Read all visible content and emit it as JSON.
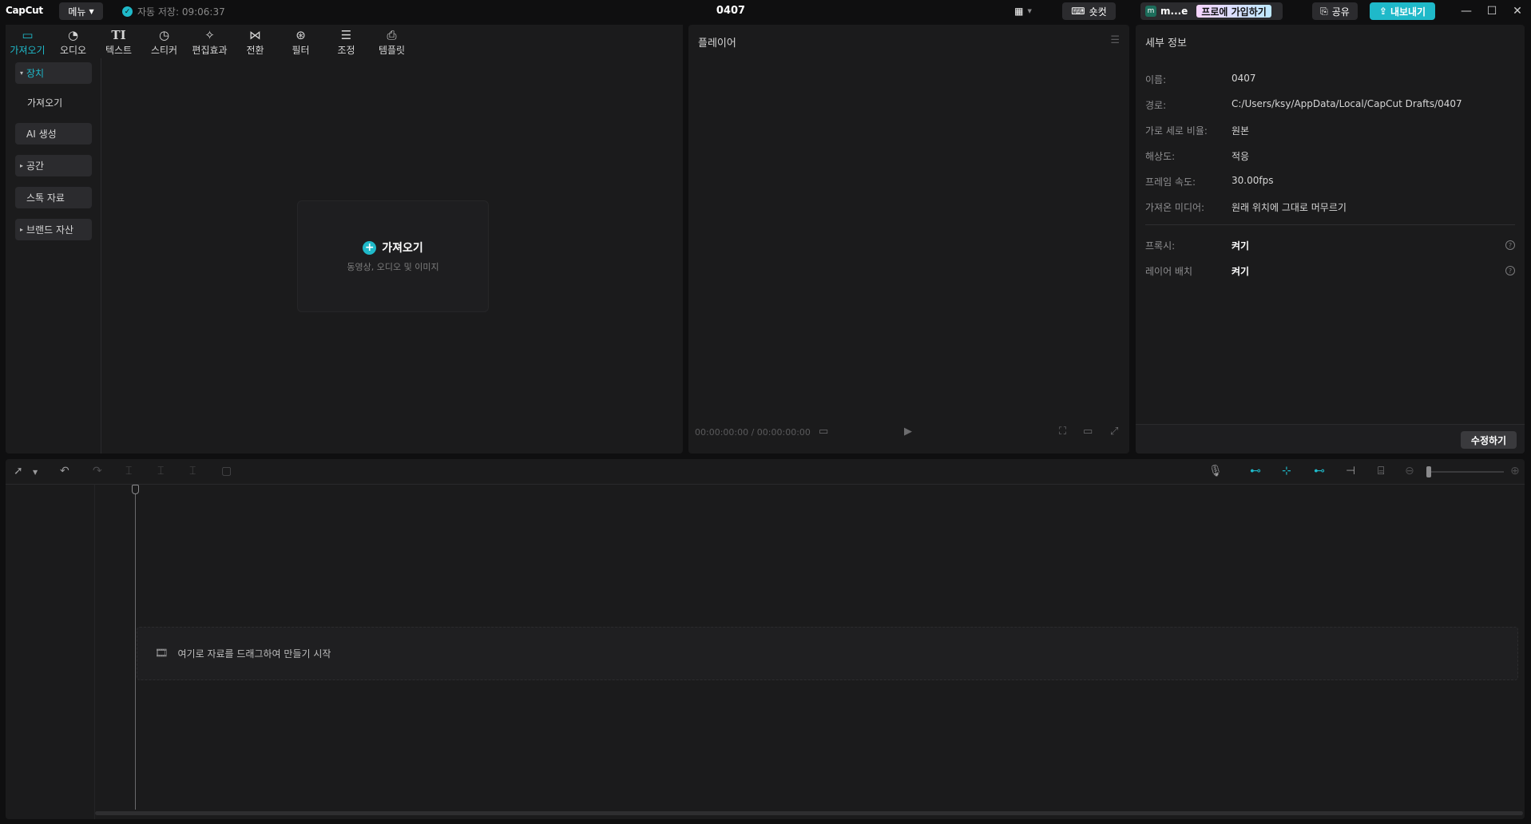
{
  "topbar": {
    "logo": "CapCut",
    "menu_label": "메뉴",
    "autosave": "자동 저장: 09:06:37",
    "project_title": "0407",
    "shortcut_label": "숏컷",
    "username": "m...e",
    "pro_join_label": "프로에 가입하기",
    "share_label": "공유",
    "export_label": "내보내기"
  },
  "media": {
    "tabs": [
      {
        "label": "가져오기",
        "icon": "import-icon"
      },
      {
        "label": "오디오",
        "icon": "audio-icon"
      },
      {
        "label": "텍스트",
        "icon": "text-icon"
      },
      {
        "label": "스티커",
        "icon": "sticker-icon"
      },
      {
        "label": "편집효과",
        "icon": "effects-icon"
      },
      {
        "label": "전환",
        "icon": "transition-icon"
      },
      {
        "label": "필터",
        "icon": "filter-icon"
      },
      {
        "label": "조정",
        "icon": "adjust-icon"
      },
      {
        "label": "템플릿",
        "icon": "template-icon"
      }
    ],
    "sidebar": [
      {
        "label": "장치"
      },
      {
        "label": "가져오기"
      },
      {
        "label": "AI 생성"
      },
      {
        "label": "공간"
      },
      {
        "label": "스톡 자료"
      },
      {
        "label": "브랜드 자산"
      }
    ],
    "import_card": {
      "title": "가져오기",
      "subtitle": "동영상, 오디오 및 이미지"
    }
  },
  "player": {
    "title": "플레이어",
    "timecode": "00:00:00:00 / 00:00:00:00"
  },
  "details": {
    "title": "세부 정보",
    "rows": [
      {
        "label": "이름:",
        "value": "0407"
      },
      {
        "label": "경로:",
        "value": "C:/Users/ksy/AppData/Local/CapCut Drafts/0407"
      },
      {
        "label": "가로 세로 비율:",
        "value": "원본"
      },
      {
        "label": "해상도:",
        "value": "적응"
      },
      {
        "label": "프레임 속도:",
        "value": "30.00fps"
      },
      {
        "label": "가져온 미디어:",
        "value": "원래 위치에 그대로 머무르기"
      },
      {
        "label": "프록시:",
        "value": "켜기"
      },
      {
        "label": "레이어 배치",
        "value": "켜기"
      }
    ],
    "edit_label": "수정하기"
  },
  "timeline": {
    "drop_hint": "여기로 자료를 드래그하여 만들기 시작"
  },
  "colors": {
    "accent": "#1fb9c9",
    "panel": "#1b1b1c",
    "background": "#0f0f10"
  }
}
